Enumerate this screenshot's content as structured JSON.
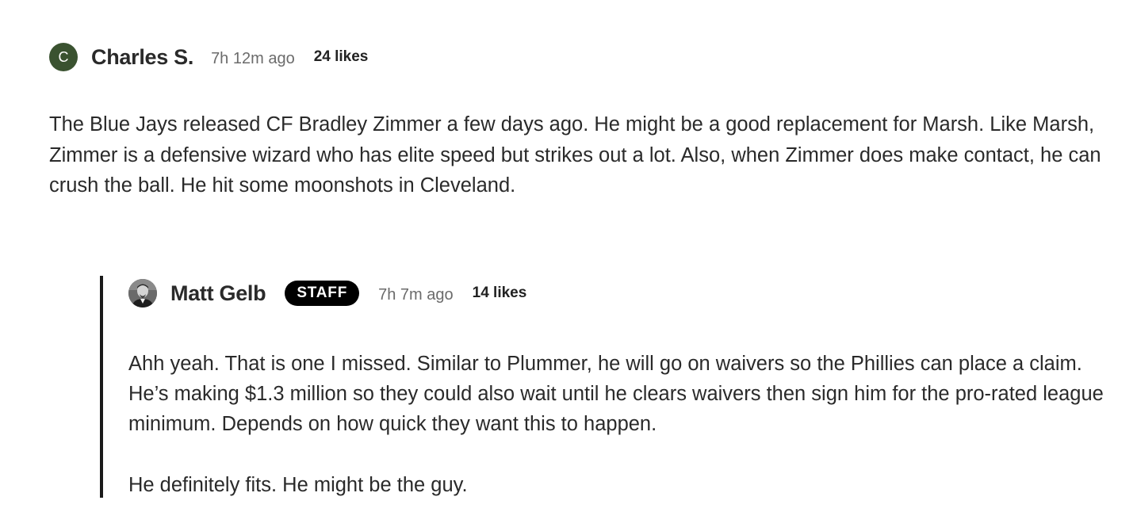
{
  "comment": {
    "avatar_letter": "C",
    "avatar_color": "#3a5230",
    "author": "Charles S.",
    "timestamp": "7h 12m ago",
    "likes": "24 likes",
    "body": "The Blue Jays released CF Bradley Zimmer a few days ago. He might be a good replacement for Marsh. Like Marsh, Zimmer is a defensive wizard who has elite speed but strikes out a lot. Also, when Zimmer does make contact, he can crush the ball. He hit some moonshots in Cleveland."
  },
  "reply": {
    "avatar_icon": "user-photo-icon",
    "author": "Matt Gelb",
    "badge": "STAFF",
    "timestamp": "7h 7m ago",
    "likes": "14 likes",
    "paragraphs": [
      "Ahh yeah. That is one I missed. Similar to Plummer, he will go on waivers so the Phillies can place a claim. He’s making $1.3 million so they could also wait until he clears waivers then sign him for the pro-rated league minimum. Depends on how quick they want this to happen.",
      "He definitely fits. He might be the guy."
    ]
  }
}
